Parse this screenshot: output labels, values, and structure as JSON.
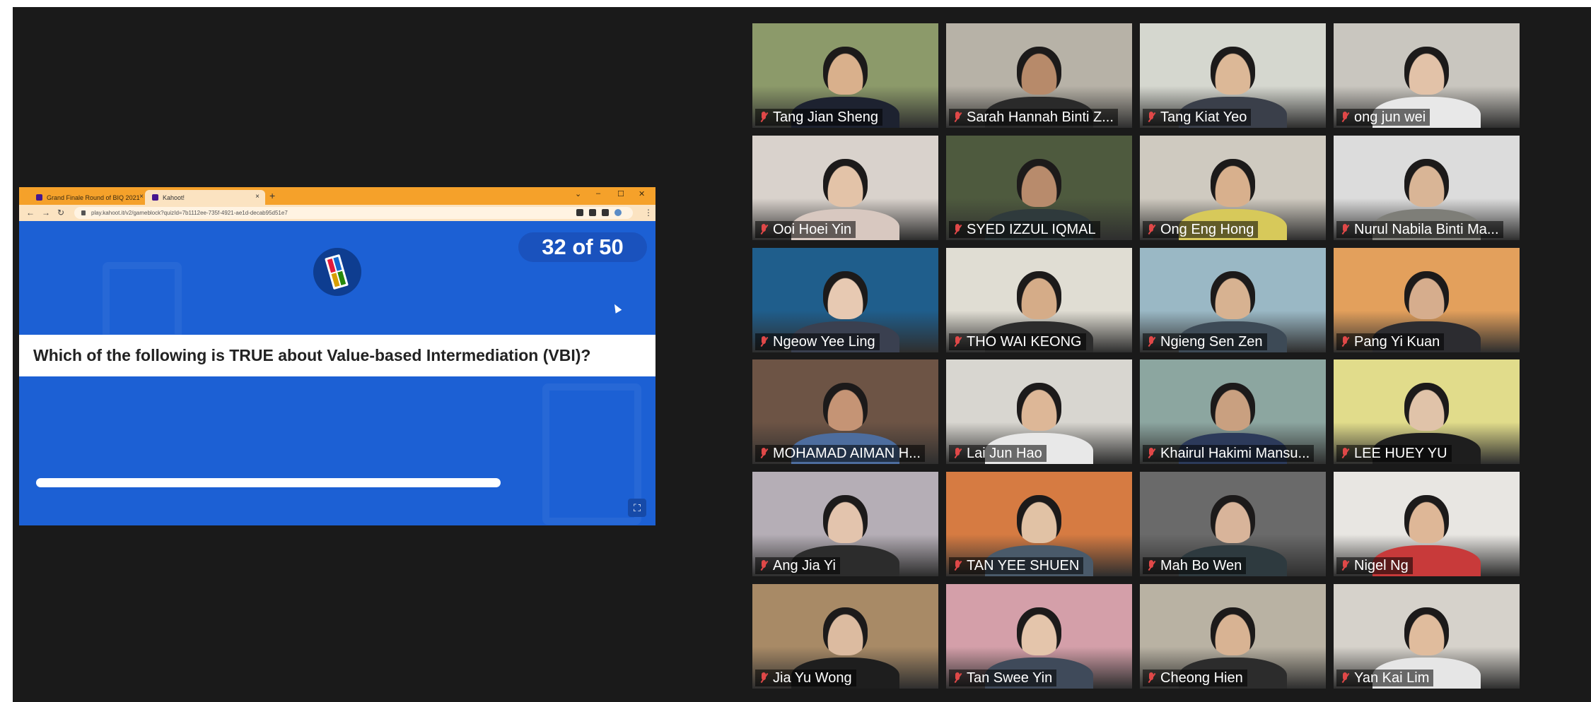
{
  "browser": {
    "tabs": [
      {
        "label": "Grand Finale Round of BIQ 2021",
        "close": "×"
      },
      {
        "label": "Kahoot!",
        "close": "×"
      }
    ],
    "new_tab": "+",
    "url": "play.kahoot.it/v2/gameblock?quizId=7b1112ee-735f-4921-ae1d-decab95d51e7",
    "window_controls": [
      "⌄",
      "–",
      "☐",
      "✕"
    ]
  },
  "kahoot": {
    "counter": "32 of 50",
    "question": "Which of the following is TRUE about Value-based Intermediation (VBI)?",
    "progress_fraction": 0.73,
    "fullscreen_icon": "⛶",
    "colors": {
      "background": "#1c60d4",
      "logo_red": "#e21b3c",
      "logo_blue": "#1368ce",
      "logo_yellow": "#d89e00",
      "logo_green": "#26890c"
    }
  },
  "participants": [
    {
      "name": "Tang Jian Sheng",
      "bg": "#8c9a6a",
      "skin": "#d9b08c",
      "shirt": "#1d2230"
    },
    {
      "name": "Sarah Hannah Binti Z...",
      "bg": "#b7b2a7",
      "skin": "#b78a6a",
      "shirt": "#2a2a2a"
    },
    {
      "name": "Tang Kiat Yeo",
      "bg": "#d5d7cf",
      "skin": "#dcb897",
      "shirt": "#3a3f4a"
    },
    {
      "name": "ong jun wei",
      "bg": "#c9c6bf",
      "skin": "#e2c2a8",
      "shirt": "#e8e8e8"
    },
    {
      "name": "Ooi Hoei Yin",
      "bg": "#d9d2cc",
      "skin": "#e3c3a8",
      "shirt": "#d8c8c0"
    },
    {
      "name": "SYED IZZUL IQMAL",
      "bg": "#4e5a3e",
      "skin": "#b88b6c",
      "shirt": "#2f3a3c"
    },
    {
      "name": "Ong Eng Hong",
      "bg": "#cfcac0",
      "skin": "#d8b08d",
      "shirt": "#d7c95a"
    },
    {
      "name": "Nurul Nabila Binti Ma...",
      "bg": "#dcdcdc",
      "skin": "#d9b596",
      "shirt": "#7e7e78"
    },
    {
      "name": "Ngeow Yee Ling",
      "bg": "#1f5e8c",
      "skin": "#e7c9b2",
      "shirt": "#3a4050"
    },
    {
      "name": "THO WAI KEONG",
      "bg": "#e0ddd3",
      "skin": "#d5ac88",
      "shirt": "#2c2c2c"
    },
    {
      "name": "Ngieng Sen Zen",
      "bg": "#9ab8c5",
      "skin": "#d7b291",
      "shirt": "#3d4a56"
    },
    {
      "name": "Pang Yi Kuan",
      "bg": "#e3a05c",
      "skin": "#d6ad8d",
      "shirt": "#2c2c30"
    },
    {
      "name": "MOHAMAD AIMAN H...",
      "bg": "#6d5445",
      "skin": "#c59475",
      "shirt": "#4d6d9e"
    },
    {
      "name": "Lai Jun Hao",
      "bg": "#d8d6d0",
      "skin": "#ddb797",
      "shirt": "#e8e8e8"
    },
    {
      "name": "Khairul Hakimi Mansu...",
      "bg": "#8ca6a0",
      "skin": "#c9a080",
      "shirt": "#2c3a5a"
    },
    {
      "name": "LEE HUEY YU",
      "bg": "#e1dc8b",
      "skin": "#e0c3a9",
      "shirt": "#1e1e1e"
    },
    {
      "name": "Ang Jia Yi",
      "bg": "#b5aeb6",
      "skin": "#e3c4ad",
      "shirt": "#2c2c2c"
    },
    {
      "name": "TAN YEE SHUEN",
      "bg": "#d67b42",
      "skin": "#e1c2a5",
      "shirt": "#4a5a6a"
    },
    {
      "name": "Mah Bo Wen",
      "bg": "#6a6a6a",
      "skin": "#d8b49a",
      "shirt": "#2e3a3f"
    },
    {
      "name": "Nigel Ng",
      "bg": "#e8e6e2",
      "skin": "#deb797",
      "shirt": "#c83a3a"
    },
    {
      "name": "Jia Yu Wong",
      "bg": "#a88a66",
      "skin": "#dcbba0",
      "shirt": "#1e1e1e"
    },
    {
      "name": "Tan Swee Yin",
      "bg": "#d49fa9",
      "skin": "#e4c5ab",
      "shirt": "#3f4a5a"
    },
    {
      "name": "Cheong Hien",
      "bg": "#b9b2a3",
      "skin": "#d8b393",
      "shirt": "#2c2c2c"
    },
    {
      "name": "Yan Kai Lim",
      "bg": "#d6d2cb",
      "skin": "#e0bc9d",
      "shirt": "#e6e6e6"
    }
  ]
}
